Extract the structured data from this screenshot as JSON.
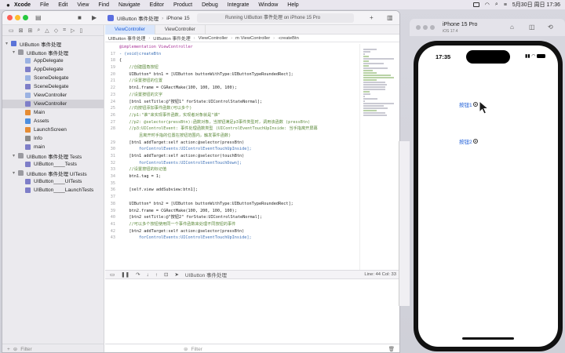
{
  "menubar": {
    "apple": "",
    "items": [
      "Xcode",
      "File",
      "Edit",
      "View",
      "Find",
      "Navigate",
      "Editor",
      "Product",
      "Debug",
      "Integrate",
      "Window",
      "Help"
    ],
    "clock": "5月30日 周日 17:36"
  },
  "toolbar": {
    "scheme": "UIButton 事件处理",
    "destination": "iPhone 15",
    "run_status": "Running UIButton 事件处理 on iPhone 15 Pro"
  },
  "navigator": {
    "items": [
      {
        "label": "UIButton 事件处理",
        "icon": "project-icon",
        "level": 0,
        "chevron": "▾"
      },
      {
        "label": "UIButton 事件处理",
        "icon": "folder-icon",
        "level": 1,
        "chevron": "▾"
      },
      {
        "label": "AppDelegate",
        "icon": "header-file-icon",
        "level": 2,
        "chevron": ""
      },
      {
        "label": "AppDelegate",
        "icon": "m-file-icon",
        "level": 2,
        "chevron": ""
      },
      {
        "label": "SceneDelegate",
        "icon": "header-file-icon",
        "level": 2,
        "chevron": ""
      },
      {
        "label": "SceneDelegate",
        "icon": "m-file-icon",
        "level": 2,
        "chevron": ""
      },
      {
        "label": "ViewController",
        "icon": "header-file-icon",
        "level": 2,
        "chevron": ""
      },
      {
        "label": "ViewController",
        "icon": "m-file-icon",
        "level": 2,
        "chevron": "",
        "selected": true
      },
      {
        "label": "Main",
        "icon": "storyboard-icon",
        "level": 2,
        "chevron": ""
      },
      {
        "label": "Assets",
        "icon": "asset-icon",
        "level": 2,
        "chevron": ""
      },
      {
        "label": "LaunchScreen",
        "icon": "storyboard-icon",
        "level": 2,
        "chevron": ""
      },
      {
        "label": "Info",
        "icon": "plist-icon",
        "level": 2,
        "chevron": ""
      },
      {
        "label": "main",
        "icon": "m-file-icon",
        "level": 2,
        "chevron": ""
      },
      {
        "label": "UIButton 事件处理 Tests",
        "icon": "folder-icon",
        "level": 1,
        "chevron": "▾"
      },
      {
        "label": "UIButton____Tests",
        "icon": "m-file-icon",
        "level": 2,
        "chevron": ""
      },
      {
        "label": "UIButton 事件处理 UITests",
        "icon": "folder-icon",
        "level": 1,
        "chevron": "▾"
      },
      {
        "label": "UIButton____UITests",
        "icon": "m-file-icon",
        "level": 2,
        "chevron": ""
      },
      {
        "label": "UIButton____LaunchTests",
        "icon": "m-file-icon",
        "level": 2,
        "chevron": ""
      }
    ],
    "filter_placeholder": "Filter"
  },
  "editor": {
    "tabs": [
      "ViewController",
      "ViewController"
    ],
    "jumpbar": [
      "UIButton 事件处理",
      "UIButton 事件处理",
      "ViewController",
      "m ViewController",
      "-createBtn"
    ],
    "code": [
      {
        "n": "",
        "t": "@implementation ViewController",
        "c": "kw"
      },
      {
        "n": "17",
        "t": "- (void)createBtn",
        "c": "fn"
      },
      {
        "n": "18",
        "t": "{",
        "c": ""
      },
      {
        "n": "19",
        "t": "    //创建圆角按钮",
        "c": "cm"
      },
      {
        "n": "20",
        "t": "    UIButton* btn1 = [UIButton buttonWithType:UIButtonTypeRoundedRect];",
        "c": ""
      },
      {
        "n": "21",
        "t": "    //设置按钮的位置",
        "c": "cm"
      },
      {
        "n": "22",
        "t": "    btn1.frame = CGRectMake(100, 100, 100, 100);",
        "c": ""
      },
      {
        "n": "23",
        "t": "    //设置按钮的文字",
        "c": "cm"
      },
      {
        "n": "24",
        "t": "    [btn1 setTitle:@\"按钮1\" forState:UIControlStateNormal];",
        "c": ""
      },
      {
        "n": "25",
        "t": "    //向按钮添加事件函数(可以多个)",
        "c": "cm"
      },
      {
        "n": "26",
        "t": "    //p1:\"谁\"来实现事件函数，实现者对象就是\"谁\"",
        "c": "cm"
      },
      {
        "n": "27",
        "t": "    //p2: @selector(pressBtn):函数对象，当按钮满足p3事件类型时，调用该函数 (pressBtn)",
        "c": "cm"
      },
      {
        "n": "28",
        "t": "    //p3:UIControlEvent: 事件处理函数类型 (UIControlEventTouchUpInside: 当手指离开屏幕",
        "c": "cm"
      },
      {
        "n": "",
        "t": "        且离开时手指的位置在按钮范围内，触发事件函数)",
        "c": "cm"
      },
      {
        "n": "29",
        "t": "    [btn1 addTarget:self action:@selector(pressBtn)",
        "c": ""
      },
      {
        "n": "30",
        "t": "        forControlEvents:UIControlEventTouchUpInside];",
        "c": "fn"
      },
      {
        "n": "31",
        "t": "    [btn1 addTarget:self action:@selector(touchBtn)",
        "c": ""
      },
      {
        "n": "32",
        "t": "        forControlEvents:UIControlEventTouchDown];",
        "c": "fn"
      },
      {
        "n": "33",
        "t": "    //设置按钮的标记值",
        "c": "cm"
      },
      {
        "n": "34",
        "t": "    btn1.tag = 1;",
        "c": ""
      },
      {
        "n": "35",
        "t": "",
        "c": ""
      },
      {
        "n": "36",
        "t": "    [self.view addSubview:btn1];",
        "c": ""
      },
      {
        "n": "37",
        "t": "",
        "c": ""
      },
      {
        "n": "38",
        "t": "    UIButton* btn2 = [UIButton buttonWithType:UIButtonTypeRoundedRect];",
        "c": ""
      },
      {
        "n": "39",
        "t": "    btn2.frame = CGRectMake(100, 200, 100, 100);",
        "c": ""
      },
      {
        "n": "40",
        "t": "    [btn2 setTitle:@\"按钮2\" forState:UIControlStateNormal];",
        "c": ""
      },
      {
        "n": "41",
        "t": "    //可以多个按钮使用同一个事件函数来处理不同按钮的事件",
        "c": "cm"
      },
      {
        "n": "42",
        "t": "    [btn2 addTarget:self action:@selector(pressBtn)",
        "c": ""
      },
      {
        "n": "43",
        "t": "        forControlEvents:UIControlEventTouchUpInside];",
        "c": "fn"
      }
    ],
    "debug_target": "UIButton 事件处理",
    "cursor_position": "Line: 44  Col: 33",
    "console_filter_placeholder": "Filter"
  },
  "simulator": {
    "device": "iPhone 15 Pro",
    "os": "iOS 17.4",
    "time": "17:35",
    "button1": "按钮1",
    "button2": "按钮2"
  }
}
